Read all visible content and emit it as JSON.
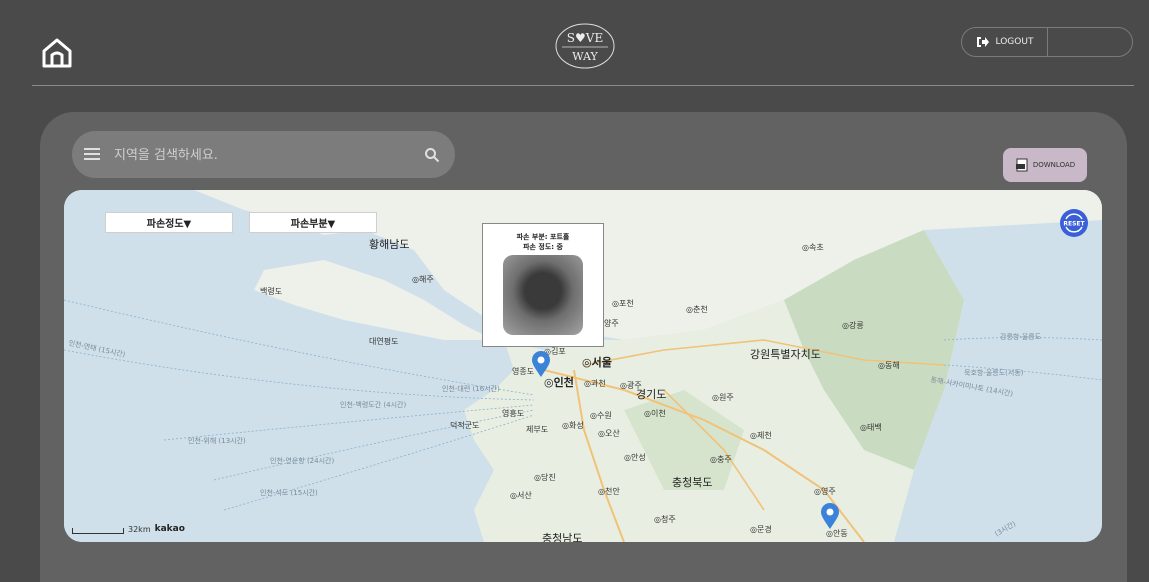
{
  "header": {
    "logo_line1": "S♥VE",
    "logo_line2": "WAY",
    "logout_label": "LOGOUT"
  },
  "search": {
    "placeholder": "지역을 검색하세요."
  },
  "download_label": "DOWNLOAD",
  "map": {
    "filters": [
      "파손정도▼",
      "파손부분▼"
    ],
    "popup": {
      "line1": "파손 부분: 포트홀",
      "line2": "파손 정도: 중"
    },
    "reset_label": "RESET",
    "scale_label": "32km",
    "attribution": "kakao",
    "labels": {
      "hwanghae": "황해남도",
      "haeju": "◎해주",
      "baengnyeong": "백령도",
      "daeyeonpyeong": "대연평도",
      "gimpo": "◎김포",
      "seoul": "◎서울",
      "incheon": "◎인천",
      "yeongjong": "영종도",
      "gwacheon": "◎과천",
      "gwangju": "◎광주",
      "gyeonggi": "경기도",
      "pocheon": "◎포천",
      "chuncheon": "◎춘천",
      "yangju": "양주",
      "gangwon": "강원특별자치도",
      "sokcho": "◎속초",
      "gangneung": "◎강릉",
      "donghae": "◎동해",
      "wonju": "◎원주",
      "icheon": "◎이천",
      "suwon": "◎수원",
      "hwaseong": "◎화성",
      "osan": "◎오산",
      "jecheon": "◎제천",
      "taebaek": "◎태백",
      "anseong": "◎안성",
      "chungju": "◎충주",
      "chungbuk": "충청북도",
      "dangjin": "◎당진",
      "cheonan": "◎천안",
      "seosan": "◎서산",
      "yeongju": "◎영주",
      "cheongju": "◎청주",
      "mungyeong": "◎문경",
      "andong": "◎안동",
      "chungnam": "충청남도",
      "yeongheungdo": "영흥도",
      "deokjeokdo": "덕적군도",
      "jebudo": "제부도",
      "route_incheon_daejeon": "인천-대련 (16시간)",
      "route_incheon_baengnyeong": "인천-백령도간 (4시간)",
      "route_incheon_yeontae": "인천-연태 (15시간)",
      "route_incheon_weihai": "인천-위해 (13시간)",
      "route_incheon_lianyungang": "인천-연운항 (24시간)",
      "route_incheon_shidao": "인천-석도 (15시간)",
      "route_gangneung_ulleung": "강릉항-울릉도",
      "route_mukho_ulleung": "묵호항-울릉도(서동)",
      "route_donghae_vladivostok": "동해-사카이미나토 (14시간)",
      "route_3h": "(3시간)"
    }
  },
  "colors": {
    "page_bg": "#4a4a4a",
    "panel_bg": "#626262",
    "marker": "#3b82d9",
    "download_bg": "#c8b8c8"
  }
}
